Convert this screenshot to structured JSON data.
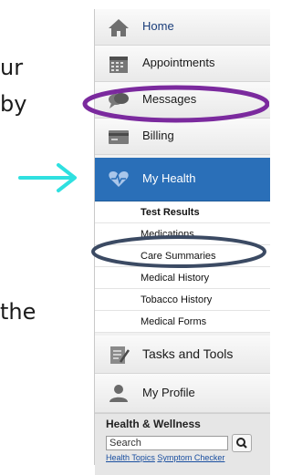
{
  "slide_fragments": [
    "ur",
    "by",
    "the"
  ],
  "colors": {
    "arrow": "#2fe0e0",
    "active_nav": "#2a6fb8",
    "messages_oval": "#7b2a9e",
    "care_oval": "#3b4a63"
  },
  "sidebar": {
    "nav": [
      {
        "label": "Home",
        "icon": "home-icon"
      },
      {
        "label": "Appointments",
        "icon": "calendar-icon"
      },
      {
        "label": "Messages",
        "icon": "chat-bubbles-icon"
      },
      {
        "label": "Billing",
        "icon": "card-icon"
      },
      {
        "label": "My Health",
        "icon": "heart-pulse-icon"
      }
    ],
    "my_health_items": [
      "Test Results",
      "Medications",
      "Care Summaries",
      "Medical History",
      "Tobacco History",
      "Medical Forms"
    ],
    "tasks": {
      "label": "Tasks and Tools",
      "icon": "checklist-icon"
    },
    "profile": {
      "label": "My Profile",
      "icon": "person-icon"
    },
    "health_wellness": {
      "title": "Health & Wellness",
      "search_placeholder": "Search",
      "search_button_icon": "search-icon",
      "links": [
        "Health Topics",
        "Symptom Checker"
      ]
    }
  }
}
